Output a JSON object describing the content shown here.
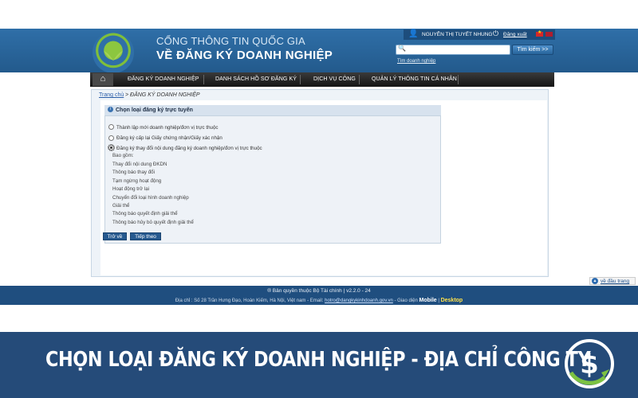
{
  "header": {
    "portal_line1": "CỔNG THÔNG TIN QUỐC GIA",
    "portal_line2": "VỀ ĐĂNG KÝ DOANH NGHIỆP",
    "user_name": "NGUYỄN THỊ TUYẾT NHUNG",
    "logout_label": "Đăng xuất",
    "search_button": "Tìm kiếm >>",
    "search_value": "",
    "advanced_search": "Tìm doanh nghiệp"
  },
  "nav": {
    "home_icon": "home-icon",
    "items": [
      {
        "label": "ĐĂNG KÝ DOANH NGHIỆP"
      },
      {
        "label": "DANH SÁCH HỒ SƠ ĐĂNG KÝ"
      },
      {
        "label": "DỊCH VỤ CÔNG"
      },
      {
        "label": "QUẢN LÝ THÔNG TIN CÁ NHÂN"
      }
    ]
  },
  "breadcrumb": {
    "home": "Trang chủ",
    "current": " > ĐĂNG KÝ DOANH NGHIỆP"
  },
  "form": {
    "title": "Chọn loại đăng ký trực tuyến",
    "options": [
      {
        "label": "Thành lập mới doanh nghiệp/đơn vị trực thuộc",
        "checked": false
      },
      {
        "label": "Đăng ký cấp lại Giấy chứng nhận/Giấy xác nhận",
        "checked": false
      },
      {
        "label": "Đăng ký thay đổi nội dung đăng ký doanh nghiệp/đơn vị trực thuộc",
        "checked": true
      }
    ],
    "includes_label": "Bao gồm:",
    "sub_items": [
      "Thay đổi nội dung ĐKDN",
      "Thông báo thay đổi",
      "Tạm ngừng hoạt động",
      "Hoạt động trở lại",
      "Chuyển đổi loại hình doanh nghiệp",
      "Giải thể",
      "Thông báo quyết định giải thể",
      "Thông báo hủy bỏ quyết định giải thể"
    ],
    "back_button": "Trở về",
    "next_button": "Tiếp theo"
  },
  "footer": {
    "copyright": "® Bản quyền thuộc Bộ Tài chính | v2.2.0 - 24",
    "address_prefix": "Địa chỉ : Số 28 Trần Hưng Đạo, Hoàn Kiếm, Hà Nội, Việt nam - Email: ",
    "email": "hotro@dangkykinhdoanh.gov.vn",
    "address_mid": " - Giao diện ",
    "mobile": "Mobile",
    "sep": " | ",
    "desktop": "Desktop",
    "back_to_top": "về đầu trang"
  },
  "banner": {
    "text": "CHỌN LOẠI ĐĂNG KÝ DOANH NGHIỆP - ĐỊA CHỈ CÔNG TY"
  },
  "colors": {
    "header_blue": "#2f6fa8",
    "nav_dark": "#151515",
    "button_blue": "#26598f",
    "banner_blue": "#254b79",
    "logo_green": "#8cc63f"
  }
}
